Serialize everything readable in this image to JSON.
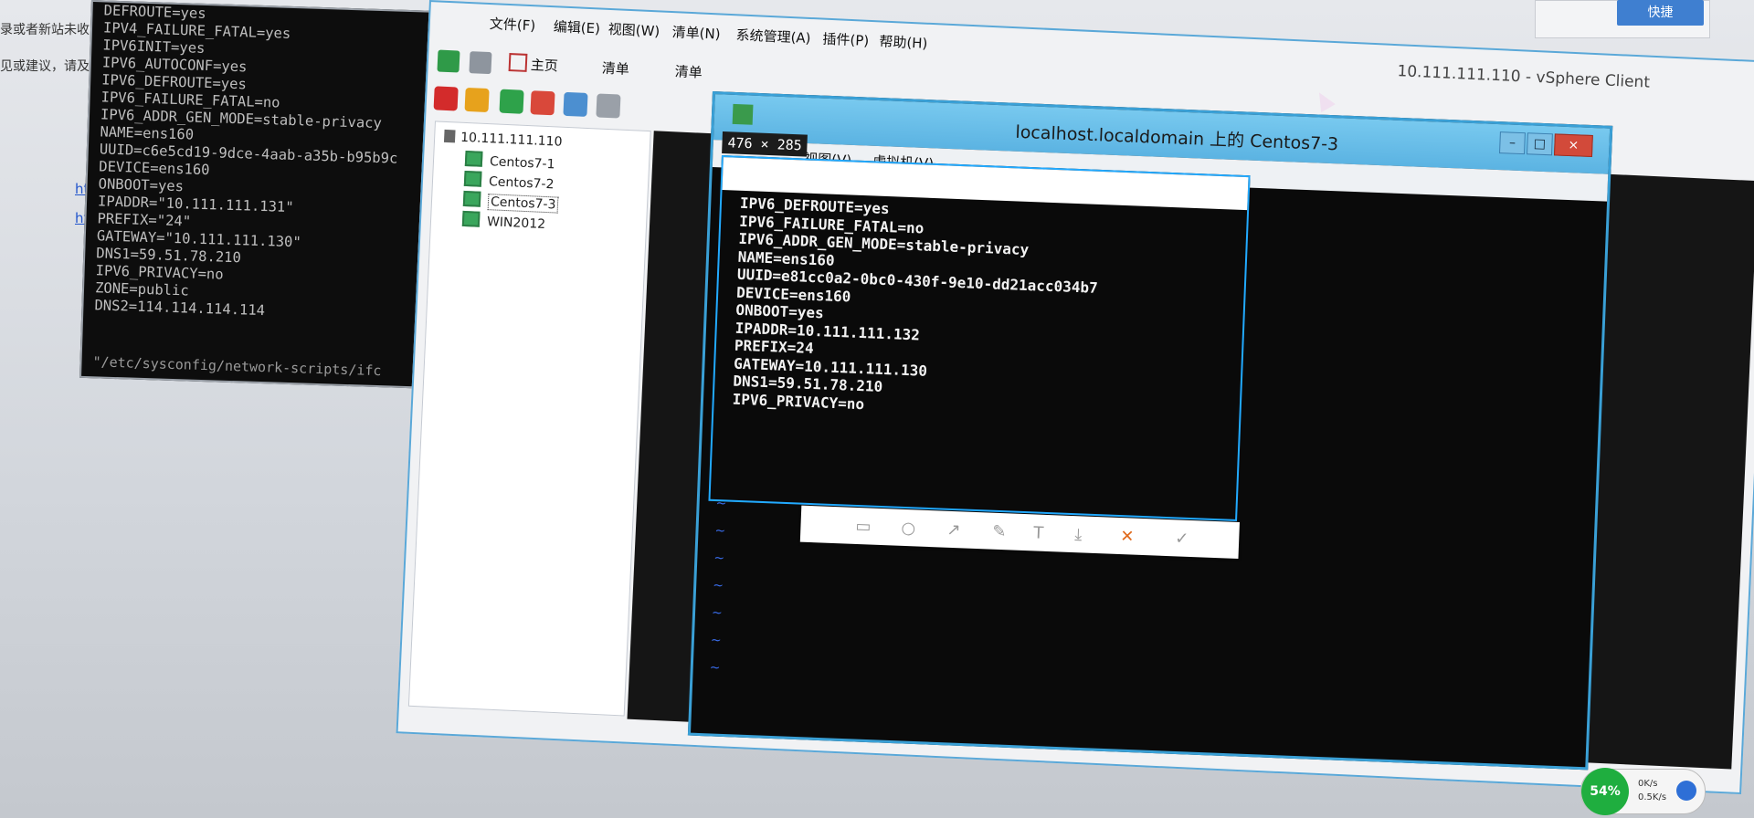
{
  "background_page": {
    "blue_button": "快捷",
    "left_texts": [
      "录或者新站未收",
      "见或建议，请及"
    ],
    "links": [
      "http",
      "http"
    ]
  },
  "left_terminal": {
    "lines": [
      "DEFROUTE=yes",
      "IPV4_FAILURE_FATAL=yes",
      "IPV6INIT=yes",
      "IPV6_AUTOCONF=yes",
      "IPV6_DEFROUTE=yes",
      "IPV6_FAILURE_FATAL=no",
      "IPV6_ADDR_GEN_MODE=stable-privacy",
      "NAME=ens160",
      "UUID=c6e5cd19-9dce-4aab-a35b-b95b9c",
      "DEVICE=ens160",
      "ONBOOT=yes",
      "IPADDR=\"10.111.111.131\"",
      "PREFIX=\"24\"",
      "GATEWAY=\"10.111.111.130\"",
      "DNS1=59.51.78.210",
      "IPV6_PRIVACY=no",
      "ZONE=public",
      "DNS2=114.114.114.114"
    ],
    "path": "\"/etc/sysconfig/network-scripts/ifc"
  },
  "vsphere": {
    "title": "10.111.111.110 - vSphere Client",
    "menu": [
      "文件(F)",
      "编辑(E)",
      "视图(W)",
      "清单(N)",
      "系统管理(A)",
      "插件(P)",
      "帮助(H)"
    ],
    "breadcrumbs": [
      "主页",
      "清单",
      "清单"
    ],
    "tree": {
      "host": "10.111.111.110",
      "vms": [
        "Centos7-1",
        "Centos7-2",
        "Centos7-3",
        "WIN2012"
      ]
    }
  },
  "console": {
    "title": "localhost.localdomain 上的 Centos7-3",
    "menu": [
      "视图(V)",
      "虚拟机(V)"
    ],
    "controls": [
      "–",
      "□",
      "×"
    ]
  },
  "selection": {
    "size_label": "476 × 285",
    "lines": [
      "IPV6_DEFROUTE=yes",
      "IPV6_FAILURE_FATAL=no",
      "IPV6_ADDR_GEN_MODE=stable-privacy",
      "NAME=ens160",
      "UUID=e81cc0a2-0bc0-430f-9e10-dd21acc034b7",
      "DEVICE=ens160",
      "ONBOOT=yes",
      "IPADDR=10.111.111.132",
      "PREFIX=24",
      "GATEWAY=10.111.111.130",
      "DNS1=59.51.78.210",
      "IPV6_PRIVACY=no"
    ],
    "tools": [
      "close-icon"
    ]
  },
  "tray": {
    "percent": "54%",
    "up": "0K/s",
    "down": "0.5K/s"
  }
}
